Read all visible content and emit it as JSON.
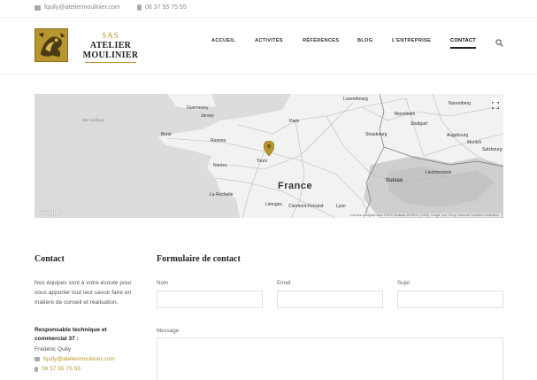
{
  "topbar": {
    "email": "fquily@ateliermoulinier.com",
    "phone": "06 37 55 75 55",
    "email_icon": "mail-icon",
    "phone_icon": "phone-icon"
  },
  "brand": {
    "sas": "SAS",
    "name": "ATELIER MOULINIER",
    "accent_color": "#b7962e"
  },
  "nav": {
    "items": [
      {
        "label": "ACCUEIL"
      },
      {
        "label": "ACTIVITÉS"
      },
      {
        "label": "RÉFÉRENCES"
      },
      {
        "label": "BLOG"
      },
      {
        "label": "L'ENTREPRISE"
      },
      {
        "label": "CONTACT",
        "active": true
      }
    ],
    "search_icon": "search-icon"
  },
  "map": {
    "labels": {
      "guernesey": "Guernesey",
      "jersey": "Jersey",
      "brest": "Brest",
      "rennes": "Rennes",
      "paris": "Paris",
      "nantes": "Nantes",
      "tours": "Tours",
      "la_rochelle": "La Rochelle",
      "limoges": "Limoges",
      "clermont": "Clermont-Ferrand",
      "lyon": "Lyon",
      "france": "France",
      "suisse": "Suisse",
      "strasbourg": "Strasbourg",
      "luxembourg": "Luxembourg",
      "mannheim": "Mannheim",
      "nuremberg": "Nuremberg",
      "stuttgart": "Stuttgart",
      "augsbourg": "Augsbourg",
      "munich": "Munich",
      "salzbourg": "Salzbourg",
      "liechtenstein": "Liechtenstein",
      "mer_celtique": "Mer Celtique"
    },
    "google": "Google",
    "attribution": "Données cartographiques ©2019 GeoBasis-DE/BKG (©2009), Google, Inst. Geogr. Nacional   Conditions d'utilisation",
    "fullscreen_icon": "fullscreen-icon",
    "pin_icon": "map-pin-icon"
  },
  "contact": {
    "title": "Contact",
    "intro": "Nos équipes sont à votre écoute pour vous apporter tout leur savoir faire en matière de conseil et réalisation.",
    "responsible_title": "Responsable technique et commercial 37 :",
    "person": "Frédéric Quily",
    "email": "fquily@ateliermoulinier.com",
    "phone": "06 37 55 75 55"
  },
  "form": {
    "title": "Formulaire de contact",
    "nom_label": "Nom",
    "nom_value": "",
    "email_label": "Email",
    "email_value": "",
    "sujet_label": "Sujet",
    "sujet_value": "",
    "message_label": "Message",
    "message_value": ""
  }
}
